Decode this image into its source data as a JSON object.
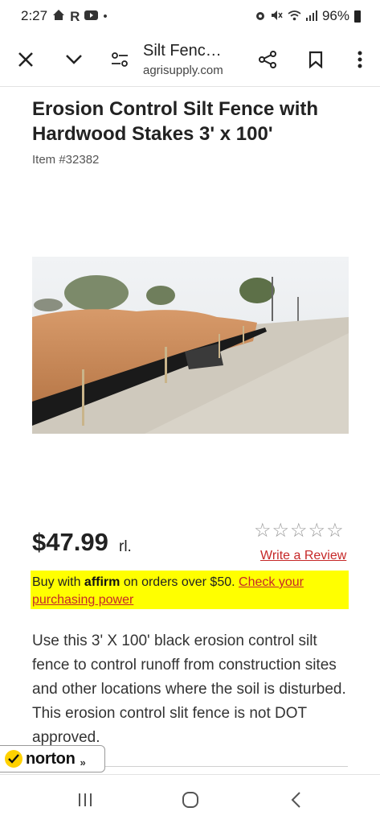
{
  "status_bar": {
    "time": "2:27",
    "battery": "96%",
    "icons_left": [
      "home-icon",
      "r-app-icon",
      "youtube-icon",
      "dot-icon"
    ],
    "icons_right": [
      "alarm-icon",
      "mute-icon",
      "wifi-icon",
      "signal-icon",
      "battery-icon"
    ]
  },
  "toolbar": {
    "page_title": "Silt Fenc…",
    "domain": "agrisupply.com",
    "icons": [
      "close-icon",
      "chevron-down-icon",
      "page-settings-icon",
      "share-icon",
      "bookmark-icon",
      "more-icon"
    ]
  },
  "product": {
    "title": "Erosion Control Silt Fence with Hardwood Stakes 3' x 100'",
    "item_number": "Item #32382",
    "price": "$47.99",
    "price_suffix": "rl.",
    "rating_stars_filled": 0,
    "rating_stars_total": 5,
    "write_review": "Write a Review"
  },
  "affirm": {
    "prefix": "Buy with ",
    "logo": "affirm",
    "middle": " on orders over $50. ",
    "link": "Check your purchasing power"
  },
  "description": "Use this 3' X 100' black erosion control silt fence to control runoff from construction sites and other locations where the soil is disturbed. This erosion control slit fence is not DOT approved.",
  "norton": {
    "label": "norton",
    "chevron": "»"
  },
  "colors": {
    "affirm_banner": "#ffff00",
    "link_red": "#c62828",
    "norton_yellow": "#ffd100"
  }
}
